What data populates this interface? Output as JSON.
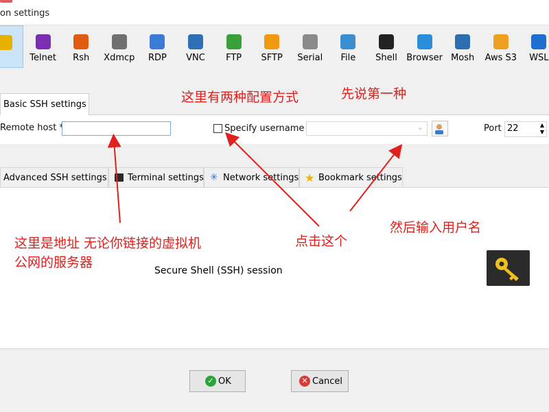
{
  "window": {
    "title": "on settings"
  },
  "toolbar": {
    "items": [
      {
        "label": "SH",
        "icon": "ssh-icon",
        "color": "#e8b000",
        "selected": true
      },
      {
        "label": "Telnet",
        "icon": "telnet-icon",
        "color": "#7a2fb0"
      },
      {
        "label": "Rsh",
        "icon": "rsh-icon",
        "color": "#e05a10"
      },
      {
        "label": "Xdmcp",
        "icon": "xdmcp-icon",
        "color": "#707070"
      },
      {
        "label": "RDP",
        "icon": "rdp-icon",
        "color": "#3a7bd5"
      },
      {
        "label": "VNC",
        "icon": "vnc-icon",
        "color": "#2f6fb8"
      },
      {
        "label": "FTP",
        "icon": "ftp-icon",
        "color": "#3aa03a"
      },
      {
        "label": "SFTP",
        "icon": "sftp-icon",
        "color": "#f09a10"
      },
      {
        "label": "Serial",
        "icon": "serial-icon",
        "color": "#8a8a8a"
      },
      {
        "label": "File",
        "icon": "file-icon",
        "color": "#3b8fd0"
      },
      {
        "label": "Shell",
        "icon": "shell-icon",
        "color": "#222222"
      },
      {
        "label": "Browser",
        "icon": "browser-icon",
        "color": "#2a8fd8"
      },
      {
        "label": "Mosh",
        "icon": "mosh-icon",
        "color": "#2c6fb0"
      },
      {
        "label": "Aws S3",
        "icon": "aws-s3-icon",
        "color": "#f0a020"
      },
      {
        "label": "WSL",
        "icon": "wsl-icon",
        "color": "#1e6fd0"
      }
    ]
  },
  "basic_tab": {
    "label": "Basic SSH settings"
  },
  "fields": {
    "remote_host_label": "Remote host *",
    "remote_host_value": "",
    "specify_username_label": "Specify username",
    "username_value": "",
    "port_label": "Port",
    "port_value": "22"
  },
  "subtabs": [
    {
      "label": "Advanced SSH settings",
      "icon": "advanced-icon"
    },
    {
      "label": "Terminal settings",
      "icon": "terminal-icon"
    },
    {
      "label": "Network settings",
      "icon": "network-icon"
    },
    {
      "label": "Bookmark settings",
      "icon": "star-icon"
    }
  ],
  "session": {
    "description": "Secure Shell (SSH) session"
  },
  "annotations": {
    "two_ways": "这里有两种配置方式",
    "first_way": "先说第一种",
    "address_line1": "这里是地址 无论你链接的虚拟机",
    "address_line2": "公网的服务器",
    "click_this": "点击这个",
    "then_username": "然后输入用户名"
  },
  "buttons": {
    "ok": "OK",
    "cancel": "Cancel"
  },
  "colors": {
    "annotation": "#e0201c",
    "key_bg": "#2b2b2b",
    "key_fg": "#f0c020"
  }
}
